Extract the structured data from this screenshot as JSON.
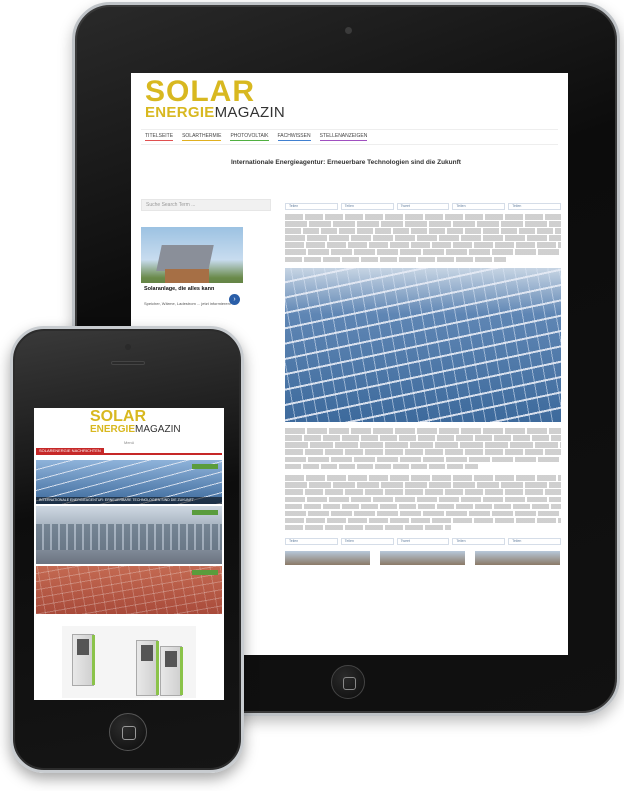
{
  "tablet": {
    "logo_top": "SOLAR",
    "logo_energie": "ENERGIE",
    "logo_magazin": "MAGAZIN",
    "nav": [
      "TITELSEITE",
      "SOLARTHERMIE",
      "PHOTOVOLTAIK",
      "FACHWISSEN",
      "STELLENANZEIGEN"
    ],
    "article_title": "Internationale Energieagentur: Erneuerbare Technologien sind die Zukunft",
    "search_placeholder": "Suche Search Term ...",
    "ad_headline": "Solaranlage, die alles kann",
    "ad_sub": "Speicher, Wärme, Ladestrom ... jetzt informieren!",
    "share": [
      "Teilen",
      "Teilen",
      "Tweet",
      "Teilen",
      "Teilen"
    ]
  },
  "phone": {
    "logo_top": "SOLAR",
    "logo_energie": "ENERGIE",
    "logo_magazin": "MAGAZIN",
    "menu": "Menü",
    "section_bar": "SOLARENERGIE NACHRICHTEN",
    "headline_caption": "INTERNATIONALE ENERGIEAGENTUR: ERNEUERBARE TECHNOLOGIEN SIND DIE ZUKUNFT"
  }
}
